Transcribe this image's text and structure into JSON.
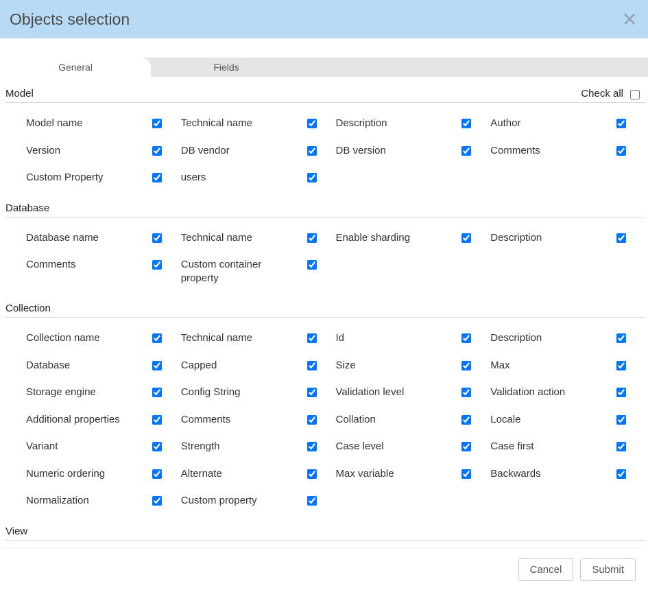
{
  "dialog": {
    "title": "Objects selection",
    "check_all_label": "Check all",
    "check_all_checked": false
  },
  "tabs": [
    {
      "label": "General",
      "active": true
    },
    {
      "label": "Fields",
      "active": false
    }
  ],
  "sections": [
    {
      "title": "Model",
      "show_check_all": true,
      "items": [
        {
          "label": "Model name",
          "checked": true
        },
        {
          "label": "Technical name",
          "checked": true
        },
        {
          "label": "Description",
          "checked": true
        },
        {
          "label": "Author",
          "checked": true
        },
        {
          "label": "Version",
          "checked": true
        },
        {
          "label": "DB vendor",
          "checked": true
        },
        {
          "label": "DB version",
          "checked": true
        },
        {
          "label": "Comments",
          "checked": true
        },
        {
          "label": "Custom Property",
          "checked": true
        },
        {
          "label": "users",
          "checked": true
        }
      ]
    },
    {
      "title": "Database",
      "show_check_all": false,
      "items": [
        {
          "label": "Database name",
          "checked": true
        },
        {
          "label": "Technical name",
          "checked": true
        },
        {
          "label": "Enable sharding",
          "checked": true
        },
        {
          "label": "Description",
          "checked": true
        },
        {
          "label": "Comments",
          "checked": true
        },
        {
          "label": "Custom container property",
          "checked": true
        }
      ]
    },
    {
      "title": "Collection",
      "show_check_all": false,
      "items": [
        {
          "label": "Collection name",
          "checked": true
        },
        {
          "label": "Technical name",
          "checked": true
        },
        {
          "label": "Id",
          "checked": true
        },
        {
          "label": "Description",
          "checked": true
        },
        {
          "label": "Database",
          "checked": true
        },
        {
          "label": "Capped",
          "checked": true
        },
        {
          "label": "Size",
          "checked": true
        },
        {
          "label": "Max",
          "checked": true
        },
        {
          "label": "Storage engine",
          "checked": true
        },
        {
          "label": "Config String",
          "checked": true
        },
        {
          "label": "Validation level",
          "checked": true
        },
        {
          "label": "Validation action",
          "checked": true
        },
        {
          "label": "Additional properties",
          "checked": true
        },
        {
          "label": "Comments",
          "checked": true
        },
        {
          "label": "Collation",
          "checked": true
        },
        {
          "label": "Locale",
          "checked": true
        },
        {
          "label": "Variant",
          "checked": true
        },
        {
          "label": "Strength",
          "checked": true
        },
        {
          "label": "Case level",
          "checked": true
        },
        {
          "label": "Case first",
          "checked": true
        },
        {
          "label": "Numeric ordering",
          "checked": true
        },
        {
          "label": "Alternate",
          "checked": true
        },
        {
          "label": "Max variable",
          "checked": true
        },
        {
          "label": "Backwards",
          "checked": true
        },
        {
          "label": "Normalization",
          "checked": true
        },
        {
          "label": "Custom property",
          "checked": true
        }
      ]
    },
    {
      "title": "View",
      "show_check_all": false,
      "items": []
    }
  ],
  "footer": {
    "cancel": "Cancel",
    "submit": "Submit"
  }
}
